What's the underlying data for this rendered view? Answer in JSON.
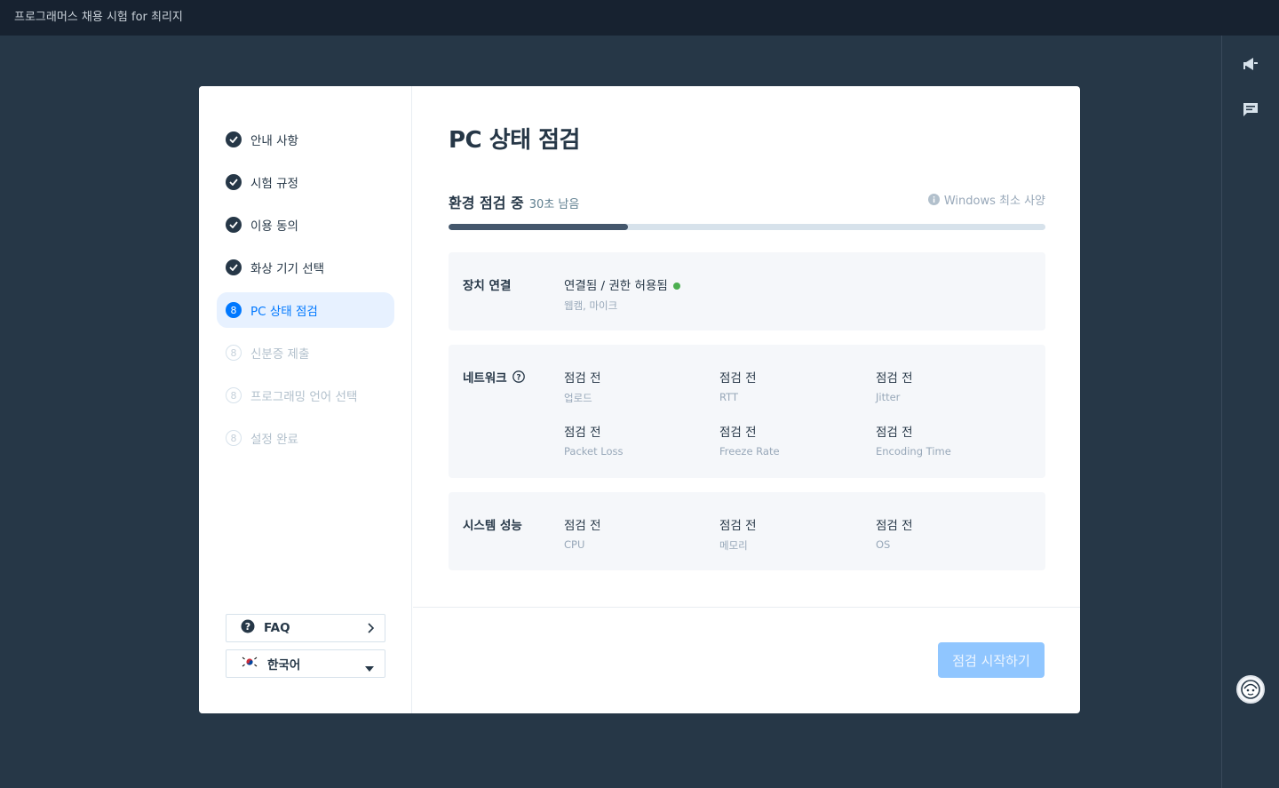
{
  "app": {
    "title": "프로그래머스 채용 시험 for 최리지"
  },
  "sidebar": {
    "steps": [
      {
        "label": "안내 사항",
        "state": "done"
      },
      {
        "label": "시험 규정",
        "state": "done"
      },
      {
        "label": "이용 동의",
        "state": "done"
      },
      {
        "label": "화상 기기 선택",
        "state": "done"
      },
      {
        "label": "PC 상태 점검",
        "state": "active",
        "number": "8"
      },
      {
        "label": "신분증 제출",
        "state": "pending",
        "number": "8"
      },
      {
        "label": "프로그래밍 언어 선택",
        "state": "pending",
        "number": "8"
      },
      {
        "label": "설정 완료",
        "state": "pending",
        "number": "8"
      }
    ],
    "faq_label": "FAQ",
    "language_label": "한국어"
  },
  "main": {
    "title": "PC 상태 점검",
    "status_label": "환경 점검 중",
    "remaining": "30초 남음",
    "requirements_link": "Windows 최소 사양",
    "progress_fraction": 0.3,
    "device": {
      "title": "장치 연결",
      "value": "연결됨 / 권한 허용됨",
      "sub": "웹캠, 마이크"
    },
    "network": {
      "title": "네트워크",
      "items": [
        {
          "value": "점검 전",
          "key": "업로드"
        },
        {
          "value": "점검 전",
          "key": "RTT"
        },
        {
          "value": "점검 전",
          "key": "Jitter"
        },
        {
          "value": "점검 전",
          "key": "Packet Loss"
        },
        {
          "value": "점검 전",
          "key": "Freeze Rate"
        },
        {
          "value": "점검 전",
          "key": "Encoding Time"
        }
      ]
    },
    "system": {
      "title": "시스템 성능",
      "items": [
        {
          "value": "점검 전",
          "key": "CPU"
        },
        {
          "value": "점검 전",
          "key": "메모리"
        },
        {
          "value": "점검 전",
          "key": "OS"
        }
      ]
    },
    "start_button": "점검 시작하기"
  },
  "colors": {
    "accent": "#0078ff",
    "background": "#263747",
    "topbar": "#172230",
    "status_ok": "#4caf50",
    "button_disabled": "#90c6ff"
  },
  "icons": {
    "rail": [
      "megaphone-icon",
      "chat-icon",
      "support-avatar-icon"
    ],
    "step_done": "check-circle-icon"
  }
}
